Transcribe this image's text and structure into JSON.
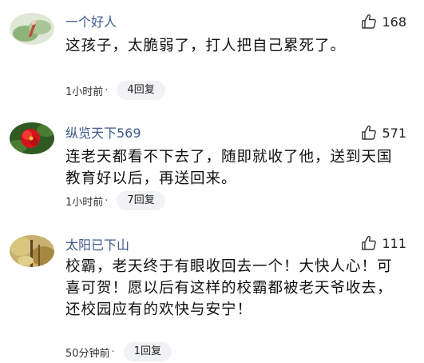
{
  "comments": [
    {
      "username": "一个好人",
      "likes": "168",
      "text": "这孩子，太脆弱了，打人把自己累死了。",
      "time": "1小时前",
      "dot": "·",
      "replies": "4回复",
      "avatar_icon": "green-plant-avatar"
    },
    {
      "username": "纵览天下569",
      "likes": "571",
      "text": "连老天都看不下去了，随即就收了他，送到天国教育好以后，再送回来。",
      "time": "1小时前",
      "dot": "·",
      "replies": "7回复",
      "avatar_icon": "red-flower-avatar"
    },
    {
      "username": "太阳已下山",
      "likes": "111",
      "text": "校霸，老天终于有眼收回去一个！大快人心！可喜可贺！愿以后有这样的校霸都被老天爷收去，还校园应有的欢快与安宁！",
      "time": "50分钟前",
      "dot": "·",
      "replies": "1回复",
      "avatar_icon": "autumn-tree-avatar"
    }
  ],
  "colors": {
    "username": "#3e5a8c",
    "reply_pill_bg": "#f1f2f4"
  }
}
